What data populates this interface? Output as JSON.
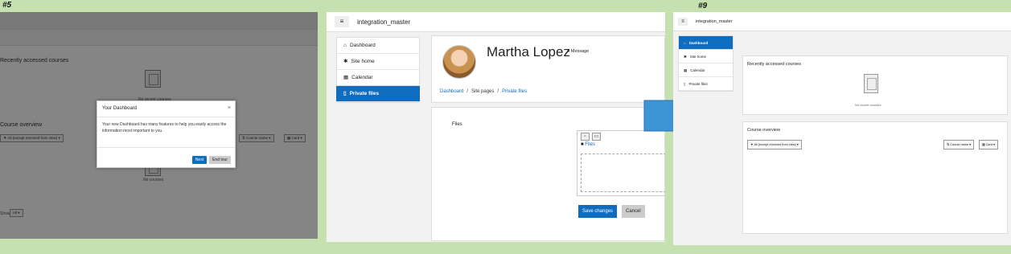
{
  "labels": {
    "left": "#5",
    "right": "#9"
  },
  "left_panel": {
    "recent_title": "Recently accessed courses",
    "no_recent": "No recent courses",
    "overview_title": "Course overview",
    "filter_label": "All (except removed from view)",
    "sort_label": "Course name",
    "view_label": "Card",
    "no_courses": "No courses",
    "show_label": "Show",
    "show_value": "All",
    "modal": {
      "title": "Your Dashboard",
      "close": "×",
      "body": "Your new Dashboard has many features to help you easily access the information most important to you.",
      "next": "Next",
      "end": "End tour"
    }
  },
  "middle_panel": {
    "site_name": "integration_master",
    "menu_glyph": "≡",
    "drawer": [
      {
        "icon": "⌂",
        "label": "Dashboard",
        "active": false
      },
      {
        "icon": "✱",
        "label": "Site home",
        "active": false
      },
      {
        "icon": "▦",
        "label": "Calendar",
        "active": false
      },
      {
        "icon": "▯",
        "label": "Private files",
        "active": true
      }
    ],
    "user_name": "Martha Lopez",
    "message_label": "Message",
    "breadcrumb": [
      {
        "label": "Dashboard",
        "link": true
      },
      {
        "label": "Site pages",
        "link": false
      },
      {
        "label": "Private files",
        "link": true
      }
    ],
    "breadcrumb_sep": "/",
    "files_label": "Files",
    "folder_name": "Files",
    "save_label": "Save changes",
    "cancel_label": "Cancel"
  },
  "right_panel": {
    "site_name": "integration_master",
    "menu_glyph": "≡",
    "drawer": [
      {
        "icon": "⌂",
        "label": "Dashboard",
        "active": true
      },
      {
        "icon": "✱",
        "label": "Site home",
        "active": false
      },
      {
        "icon": "▦",
        "label": "Calendar",
        "active": false
      },
      {
        "icon": "▯",
        "label": "Private files",
        "active": false
      }
    ],
    "recent_title": "Recently accessed courses",
    "no_recent": "No recent courses",
    "overview_title": "Course overview",
    "filter_label": "All (except removed from view)",
    "sort_label": "Course name",
    "view_label": "Card"
  },
  "colors": {
    "accent": "#0f6cbf",
    "arrow": "#3d95d6",
    "background": "#c5e1b0"
  }
}
